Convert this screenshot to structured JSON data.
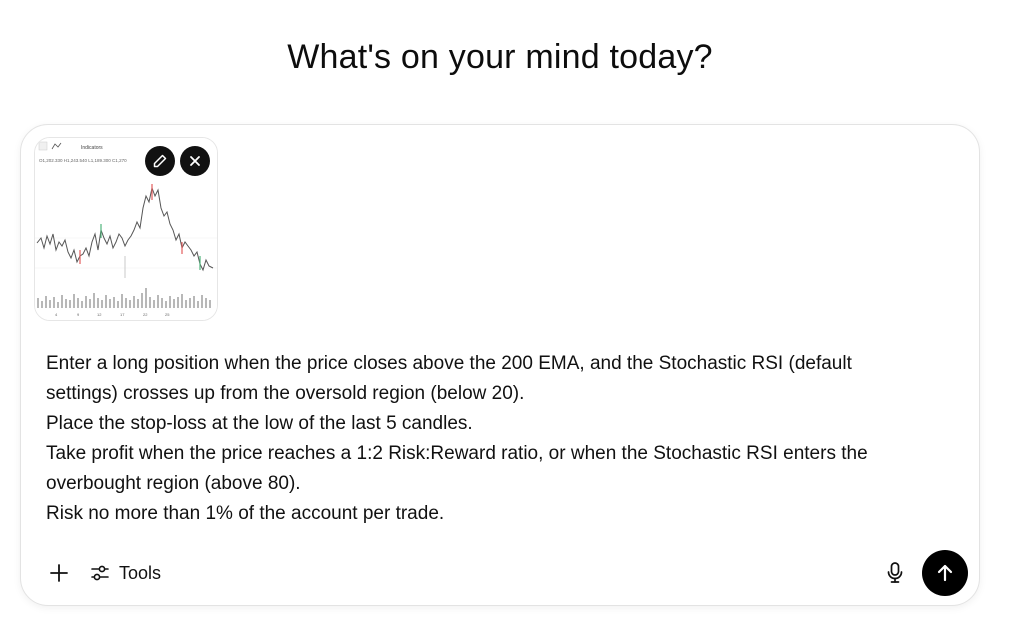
{
  "headline": "What's on your mind today?",
  "attachment": {
    "edit_icon": "pencil-icon",
    "remove_icon": "close-icon",
    "chart_toolbar_text": "Indicators",
    "chart_info_text": "O1,202.330 H1,243.540 L1,189.300 C1,270",
    "x_ticks": [
      "4",
      "9",
      "12",
      "17",
      "22",
      "25"
    ]
  },
  "prompt": {
    "lines": [
      "Enter a long position when the price closes above the 200 EMA, and the Stochastic RSI (default",
      "settings) crosses up from the oversold region (below 20).",
      "Place the stop-loss at the low of the last 5 candles.",
      "Take profit when the price reaches a 1:2 Risk:Reward ratio, or when the Stochastic RSI enters the",
      "overbought region (above 80).",
      "Risk no more than 1% of the account per trade."
    ]
  },
  "toolbar": {
    "add_icon": "plus-icon",
    "tools_icon": "sliders-icon",
    "tools_label": "Tools",
    "mic_icon": "microphone-icon",
    "send_icon": "arrow-up-icon"
  },
  "colors": {
    "send_button": "#000000",
    "border": "#e3e3e3"
  }
}
